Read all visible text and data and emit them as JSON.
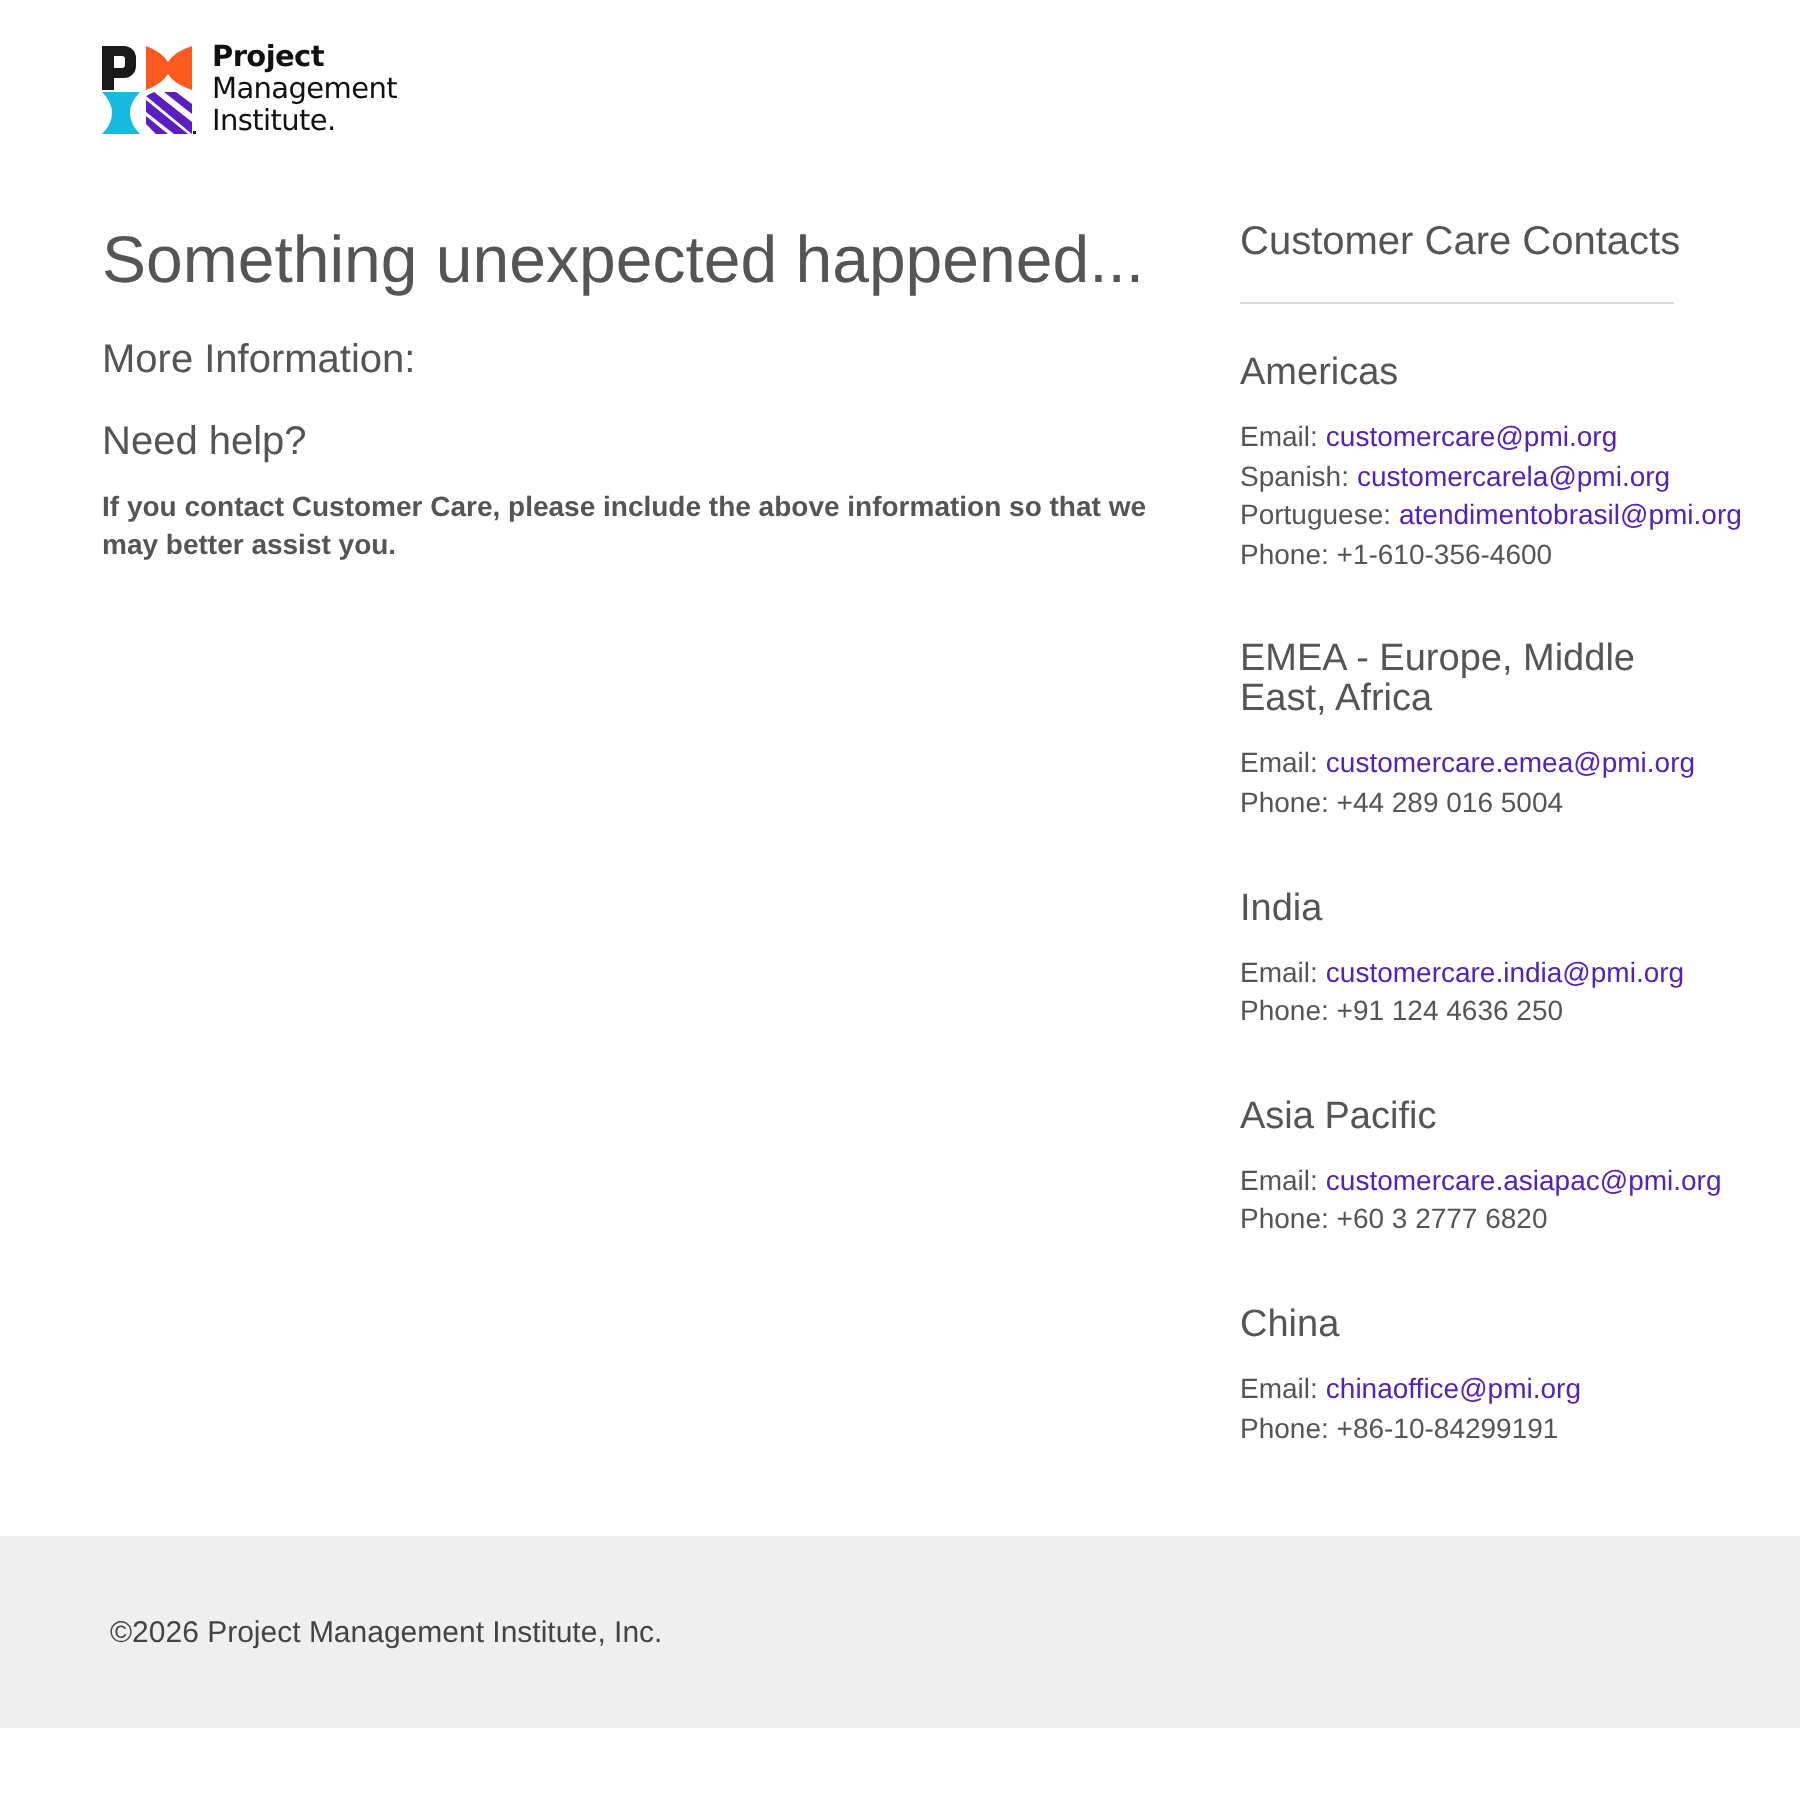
{
  "header": {
    "logo": {
      "text_lines": [
        "Project",
        "Management",
        "Institute."
      ]
    }
  },
  "main": {
    "title": "Something unexpected happened...",
    "more_information": "More Information:",
    "help": {
      "heading": "Need help?",
      "text": "If you contact Customer Care, please include the above information so that we may better assist you."
    }
  },
  "contacts": {
    "title": "Customer Care Contacts",
    "regions": [
      {
        "name": "Americas",
        "lines": [
          {
            "kind": "email",
            "label": "Email:",
            "email": "customercare@pmi.org"
          },
          {
            "kind": "email",
            "label": "Spanish:",
            "email": "customercarela@pmi.org"
          },
          {
            "kind": "email",
            "label": "Portuguese:",
            "email": "atendimentobrasil@pmi.org"
          },
          {
            "kind": "phone",
            "text": "Phone: +1-610-356-4600"
          }
        ]
      },
      {
        "name": "EMEA - Europe, Middle East, Africa",
        "lines": [
          {
            "kind": "email",
            "label": "Email:",
            "email": "customercare.emea@pmi.org"
          },
          {
            "kind": "phone",
            "text": "Phone: +44 289 016 5004"
          }
        ]
      },
      {
        "name": "India",
        "lines": [
          {
            "kind": "email",
            "label": "Email:",
            "email": "customercare.india@pmi.org"
          },
          {
            "kind": "phone",
            "text": "Phone: +91 124 4636 250"
          }
        ]
      },
      {
        "name": "Asia Pacific",
        "lines": [
          {
            "kind": "email",
            "label": "Email:",
            "email": "customercare.asiapac@pmi.org"
          },
          {
            "kind": "phone",
            "text": "Phone: +60 3 2777 6820"
          }
        ]
      },
      {
        "name": "China",
        "lines": [
          {
            "kind": "email",
            "label": "Email:",
            "email": "chinaoffice@pmi.org"
          },
          {
            "kind": "phone",
            "text": "Phone: +86-10-84299191"
          }
        ]
      }
    ]
  },
  "footer": {
    "copyright": "©2026 Project Management Institute, Inc."
  }
}
